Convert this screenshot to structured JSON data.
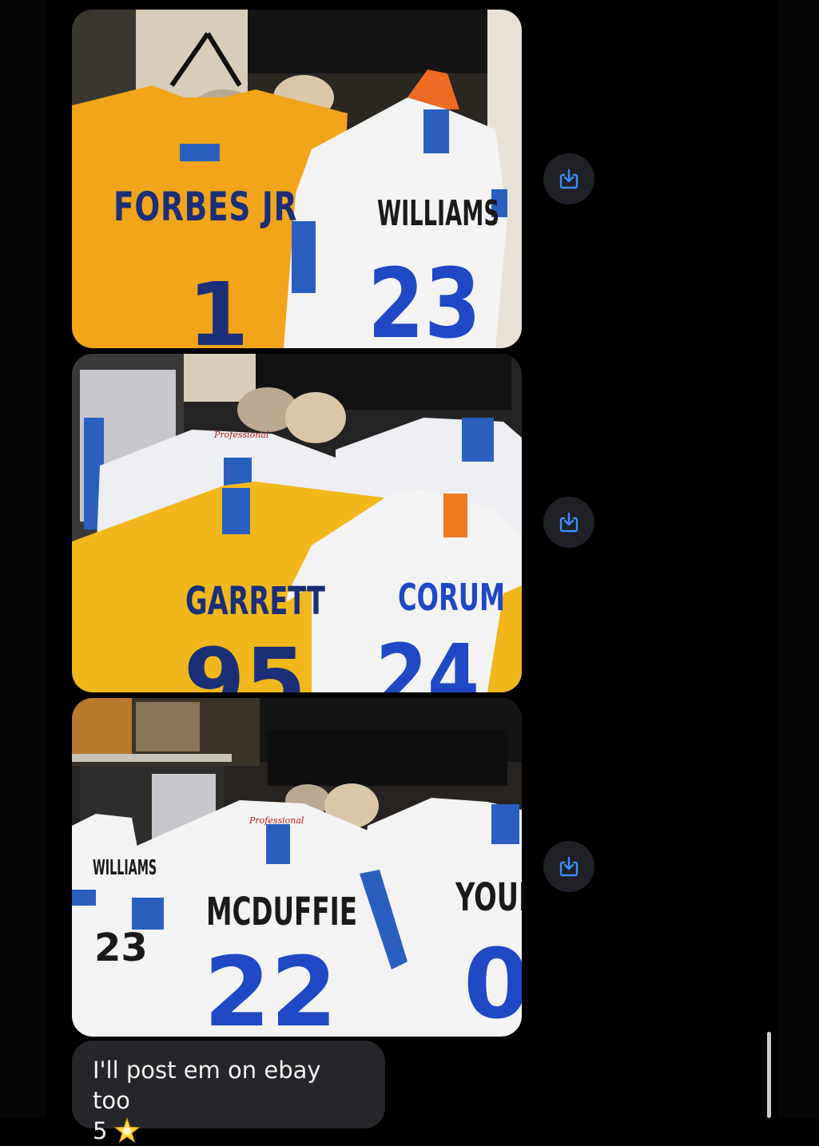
{
  "photos": [
    {
      "alt": "",
      "jerseys": [
        {
          "name": "FORBES JR",
          "number": "1",
          "style": "gold"
        },
        {
          "name": "WILLIAMS",
          "number": "23",
          "style": "white"
        }
      ],
      "save_icon": "download-icon"
    },
    {
      "alt": "",
      "jerseys": [
        {
          "name": "GARRETT",
          "number": "95",
          "style": "gold"
        },
        {
          "name": "CORUM",
          "number": "24",
          "style": "white"
        }
      ],
      "hanger_brand": "Professional",
      "save_icon": "download-icon"
    },
    {
      "alt": "",
      "jerseys": [
        {
          "name": "WILLIAMS",
          "number": "23",
          "style": "white"
        },
        {
          "name": "MCDUFFIE",
          "number": "22",
          "style": "white"
        },
        {
          "name": "YOUNG",
          "number": "0",
          "style": "white"
        }
      ],
      "hanger_brand": "Professional",
      "save_icon": "download-icon"
    }
  ],
  "message": {
    "line1": "I'll post em on ebay too",
    "line2": "5",
    "emoji": "star-icon"
  },
  "colors": {
    "background": "#000000",
    "bubble": "#26262a",
    "bubble_text": "#f2f2f2",
    "save_button": "#1f2126",
    "save_icon": "#3d8cff",
    "rams_gold": "#f2b21b",
    "rams_blue": "#1b3fa0"
  }
}
